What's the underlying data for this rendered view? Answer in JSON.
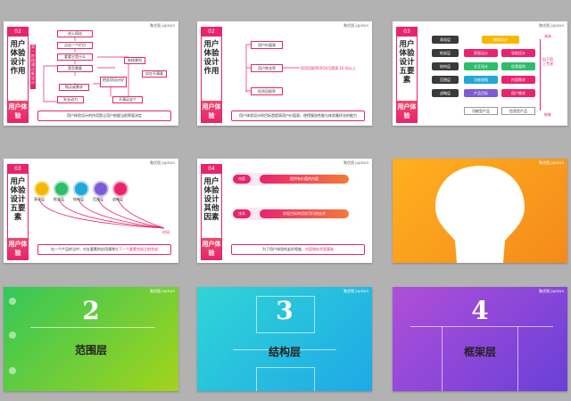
{
  "brand": "聚优图 jupicun",
  "slides": [
    {
      "num": "02",
      "title": "用户体验设计作用",
      "tag": "用户体验",
      "mid_label": "第一阶段通过新设计",
      "flow": [
        "进入网站",
        "点击一个栏目",
        "看看它是什么",
        "是否需要",
        "把此项设计好",
        "有结果吗",
        "购买或需求",
        "实在不满意",
        "失去动力",
        "不满足这个"
      ],
      "note": "用户体验设计的作用是让用户依据当前界面决定"
    },
    {
      "num": "02",
      "title": "用户体验设计作用",
      "tag": "用户体验",
      "steps": [
        "用户价值观",
        "用户转化率",
        "投资回报率"
      ],
      "metric": "投资回报率(ROI)可提高 10 倍以上",
      "note": "用户体验设计的目标是提高用户价值观，使得服务性能与体验最优化的能力"
    },
    {
      "num": "03",
      "title": "用户体验设计五要素",
      "tag": "用户体验",
      "layers": [
        "表现层",
        "框架层",
        "结构层",
        "范围层",
        "战略层"
      ],
      "cells": [
        [
          "感知设计"
        ],
        [
          "界面设计",
          "导航设计"
        ],
        [
          "交互设计",
          "信息架构"
        ],
        [
          "功能规格",
          "内容需求"
        ],
        [
          "产品目标",
          "用户需求"
        ]
      ],
      "bottom": [
        "功能型产品",
        "信息型产品"
      ],
      "right_top": "具体",
      "right_mid": "自下而上专虑",
      "right_bot": "抽象"
    },
    {
      "num": "03",
      "title": "用户体验设计五要素",
      "tag": "用户体验",
      "layers": [
        "表现层",
        "框架层",
        "结构层",
        "范围层",
        "战略层"
      ],
      "axis": "时间",
      "note_prefix": "在一个产品的当中，对五要素的应用通常",
      "note_hl": "在下一个要素完成之前完成"
    },
    {
      "num": "04",
      "title": "用户体验设计其他因素",
      "tag": "用户体验",
      "r1_tag": "内容",
      "r1_text": "提供有价值的内容",
      "r2_tag": "技术",
      "r2_text": "实现目标的切实可行的技术",
      "note_prefix": "为了用户体验的友好程度，",
      "note_hl": "内容和技术是基础"
    },
    {
      "title": ""
    },
    {
      "num": "2",
      "label": "范围层"
    },
    {
      "num": "3",
      "label": "结构层"
    },
    {
      "num": "4",
      "label": "框架层"
    }
  ],
  "colors": {
    "accent": "#e8246d",
    "layer_colors": [
      "#f5b800",
      "#2ebd6b",
      "#1fa8d8",
      "#7b5cd6",
      "#e8246d"
    ],
    "green_grad": [
      "#34c759",
      "#a3d31c"
    ],
    "cyan_grad": [
      "#2fd5d5",
      "#1fa8e8"
    ],
    "purple_grad": [
      "#b04fd8",
      "#6a3fd8"
    ],
    "orange_grad": [
      "#ffb01f",
      "#f48a1a"
    ]
  }
}
